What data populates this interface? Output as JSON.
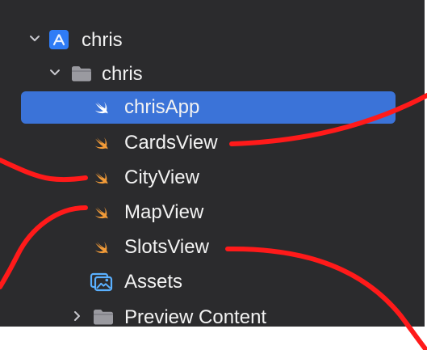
{
  "navigator": {
    "project": {
      "label": "chris",
      "icon": "xcode-project-icon",
      "expanded": true
    },
    "group": {
      "label": "chris",
      "icon": "folder-icon",
      "expanded": true
    },
    "files": [
      {
        "label": "chrisApp",
        "icon": "swift-file-icon",
        "selected": true
      },
      {
        "label": "CardsView",
        "icon": "swift-file-icon",
        "selected": false
      },
      {
        "label": "CityView",
        "icon": "swift-file-icon",
        "selected": false
      },
      {
        "label": "MapView",
        "icon": "swift-file-icon",
        "selected": false
      },
      {
        "label": "SlotsView",
        "icon": "swift-file-icon",
        "selected": false
      },
      {
        "label": "Assets",
        "icon": "asset-catalog-icon",
        "selected": false
      }
    ],
    "preview_group": {
      "label": "Preview Content",
      "icon": "folder-icon",
      "expanded": false
    }
  },
  "colors": {
    "panel_bg": "#2b2b2d",
    "selection": "#3b73d8",
    "swift_orange": "#f29b38",
    "annotation_red": "#ff1a1a",
    "folder_gray": "#9a9aa0",
    "project_blue": "#2f7cf6",
    "assets_blue": "#5ab0ff"
  }
}
